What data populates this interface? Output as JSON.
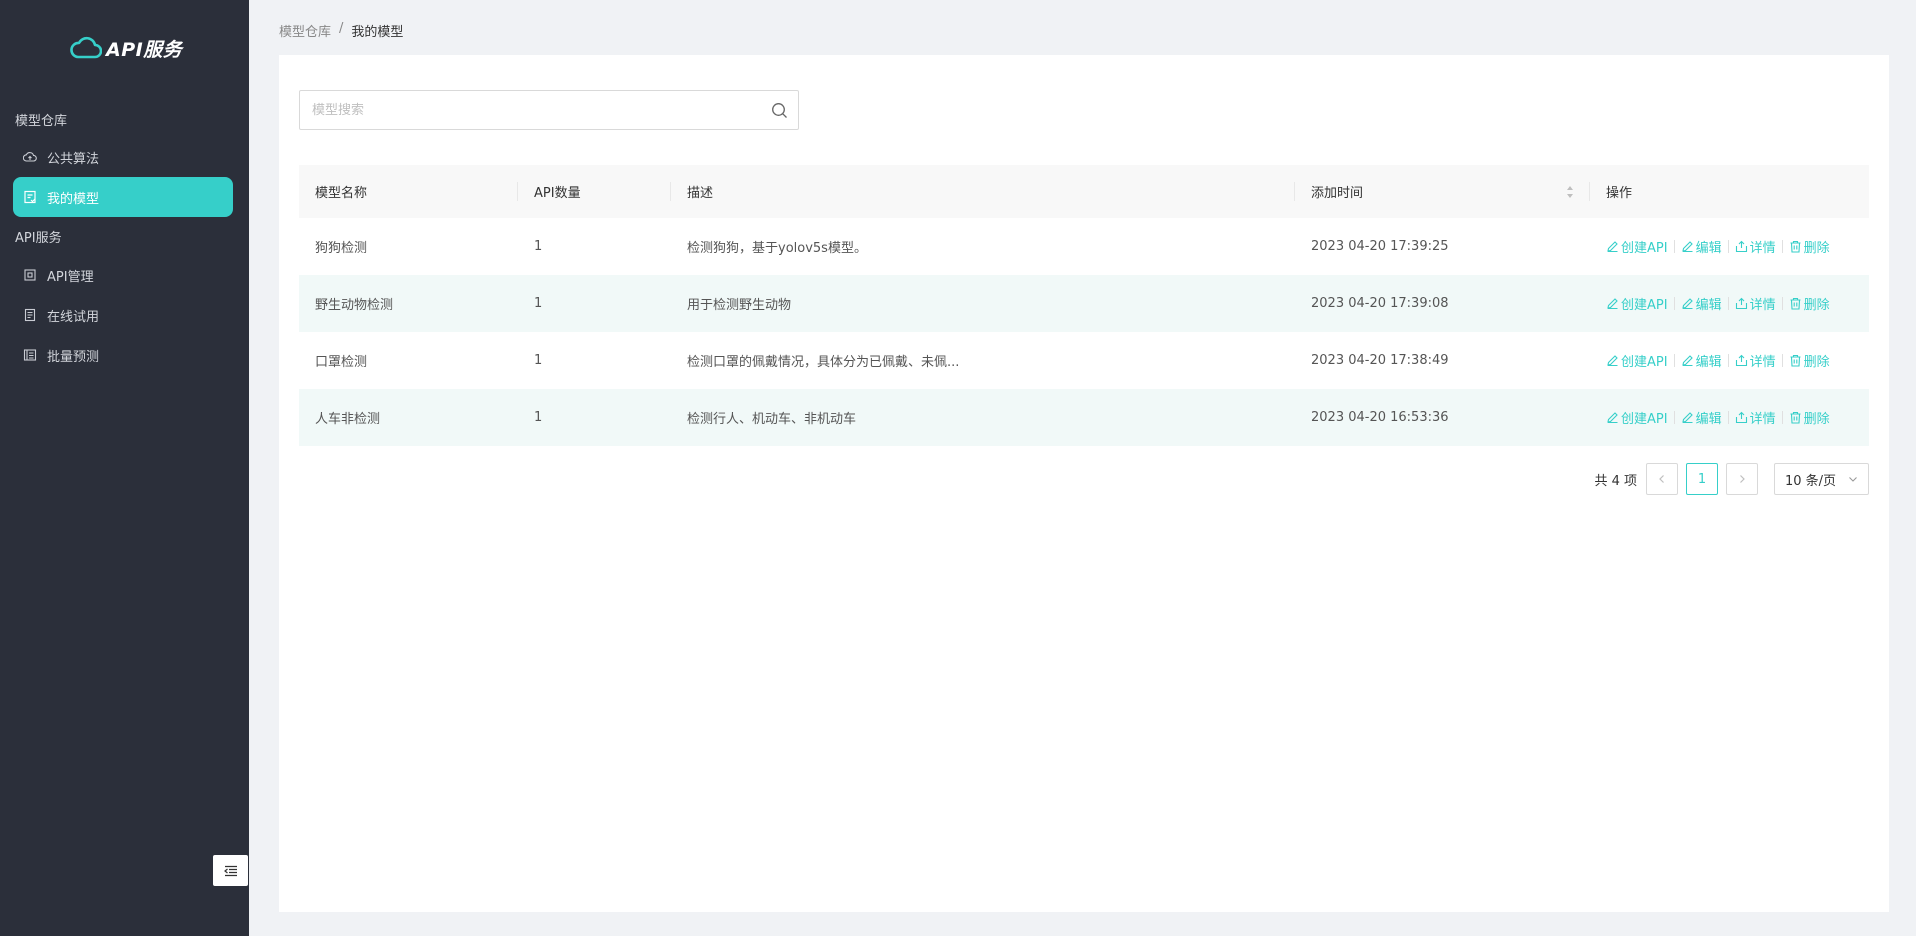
{
  "brand": {
    "name": "API服务"
  },
  "sidebar": {
    "groups": [
      {
        "title": "模型仓库",
        "items": [
          {
            "label": "公共算法",
            "icon": "cloud-upload-icon"
          },
          {
            "label": "我的模型",
            "icon": "file-icon",
            "active": true
          }
        ]
      },
      {
        "title": "API服务",
        "items": [
          {
            "label": "API管理",
            "icon": "api-icon"
          },
          {
            "label": "在线试用",
            "icon": "document-icon"
          },
          {
            "label": "批量预测",
            "icon": "batch-icon"
          }
        ]
      }
    ],
    "accent": "#36cfc9"
  },
  "breadcrumb": {
    "parent": "模型仓库",
    "separator": "/",
    "current": "我的模型"
  },
  "search": {
    "placeholder": "模型搜索",
    "value": ""
  },
  "table": {
    "columns": [
      "模型名称",
      "API数量",
      "描述",
      "添加时间",
      "操作"
    ],
    "rows": [
      {
        "name": "狗狗检测",
        "api_count": "1",
        "desc": "检测狗狗，基于yolov5s模型。",
        "time": "2023 04-20 17:39:25"
      },
      {
        "name": "野生动物检测",
        "api_count": "1",
        "desc": "用于检测野生动物",
        "time": "2023 04-20 17:39:08"
      },
      {
        "name": "口罩检测",
        "api_count": "1",
        "desc": "检测口罩的佩戴情况，具体分为已佩戴、未佩...",
        "time": "2023 04-20 17:38:49"
      },
      {
        "name": "人车非检测",
        "api_count": "1",
        "desc": "检测行人、机动车、非机动车",
        "time": "2023 04-20 16:53:36"
      }
    ],
    "actions": {
      "create": "创建API",
      "edit": "编辑",
      "detail": "详情",
      "delete": "删除"
    }
  },
  "pagination": {
    "total": "共 4 项",
    "current_page": "1",
    "page_size": "10 条/页"
  }
}
